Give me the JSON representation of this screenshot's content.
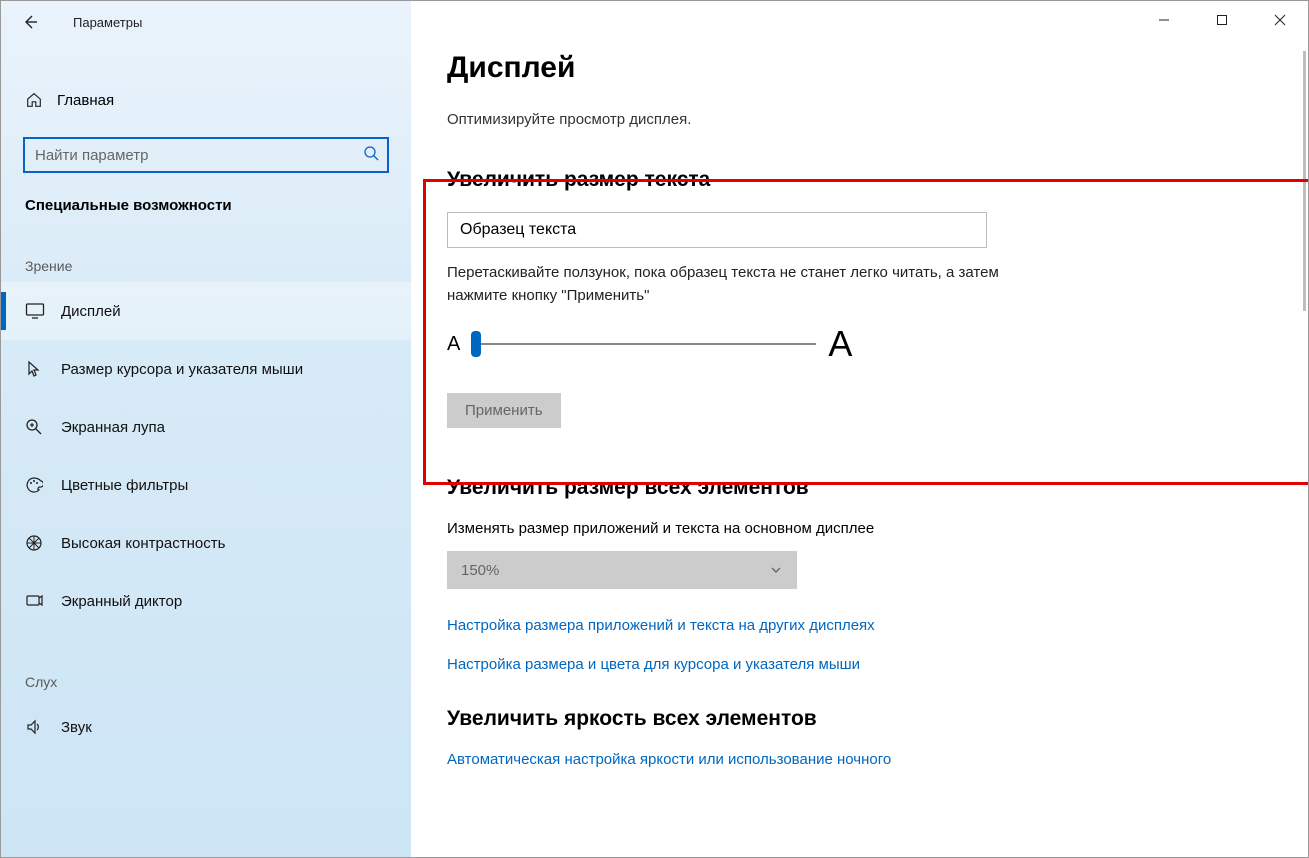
{
  "window": {
    "title": "Параметры"
  },
  "sidebar": {
    "home": "Главная",
    "search_placeholder": "Найти параметр",
    "category": "Специальные возможности",
    "groups": [
      {
        "label": "Зрение",
        "items": [
          {
            "id": "display",
            "label": "Дисплей",
            "active": true
          },
          {
            "id": "cursor",
            "label": "Размер курсора и указателя мыши"
          },
          {
            "id": "magnifier",
            "label": "Экранная лупа"
          },
          {
            "id": "filters",
            "label": "Цветные фильтры"
          },
          {
            "id": "contrast",
            "label": "Высокая контрастность"
          },
          {
            "id": "narrator",
            "label": "Экранный диктор"
          }
        ]
      },
      {
        "label": "Слух",
        "items": [
          {
            "id": "sound",
            "label": "Звук"
          }
        ]
      }
    ]
  },
  "main": {
    "title": "Дисплей",
    "subhead": "Оптимизируйте просмотр дисплея.",
    "text_size": {
      "heading": "Увеличить размер текста",
      "sample": "Образец текста",
      "hint": "Перетаскивайте ползунок, пока образец текста не станет легко читать, а затем нажмите кнопку \"Применить\"",
      "small_a": "A",
      "big_a": "A",
      "apply": "Применить"
    },
    "everything": {
      "heading": "Увеличить размер всех элементов",
      "label": "Изменять размер приложений и текста на основном дисплее",
      "value": "150%",
      "link1": "Настройка размера приложений и текста на других дисплеях",
      "link2": "Настройка размера и цвета для курсора и указателя мыши"
    },
    "brightness": {
      "heading": "Увеличить яркость всех элементов",
      "link": "Автоматическая настройка яркости или использование ночного"
    }
  }
}
